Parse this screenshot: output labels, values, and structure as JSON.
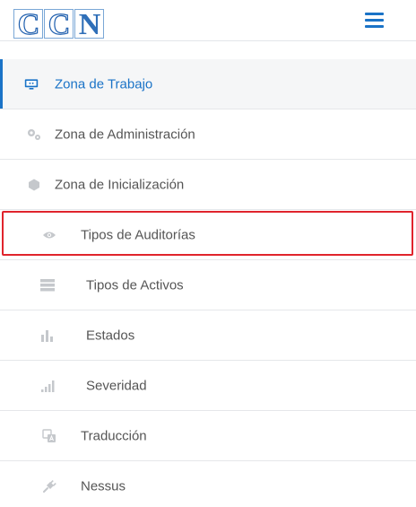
{
  "header": {
    "logo_text": "CCN",
    "menu_icon": "hamburger-menu-icon",
    "accent_color": "#1a73c7"
  },
  "menu": {
    "items": [
      {
        "label": "Zona de Trabajo",
        "icon": "monitor-icon",
        "active": true
      },
      {
        "label": "Zona de Administración",
        "icon": "gears-icon"
      },
      {
        "label": "Zona de Inicialización",
        "icon": "hexagon-icon"
      },
      {
        "label": "Tipos de Auditorías",
        "icon": "eye-icon",
        "highlighted": true
      },
      {
        "label": "Tipos de Activos",
        "icon": "server-icon"
      },
      {
        "label": "Estados",
        "icon": "bar-chart-icon"
      },
      {
        "label": "Severidad",
        "icon": "signal-icon"
      },
      {
        "label": "Traducción",
        "icon": "translate-icon"
      },
      {
        "label": "Nessus",
        "icon": "plug-icon"
      }
    ]
  },
  "highlight_color": "#e0242c"
}
